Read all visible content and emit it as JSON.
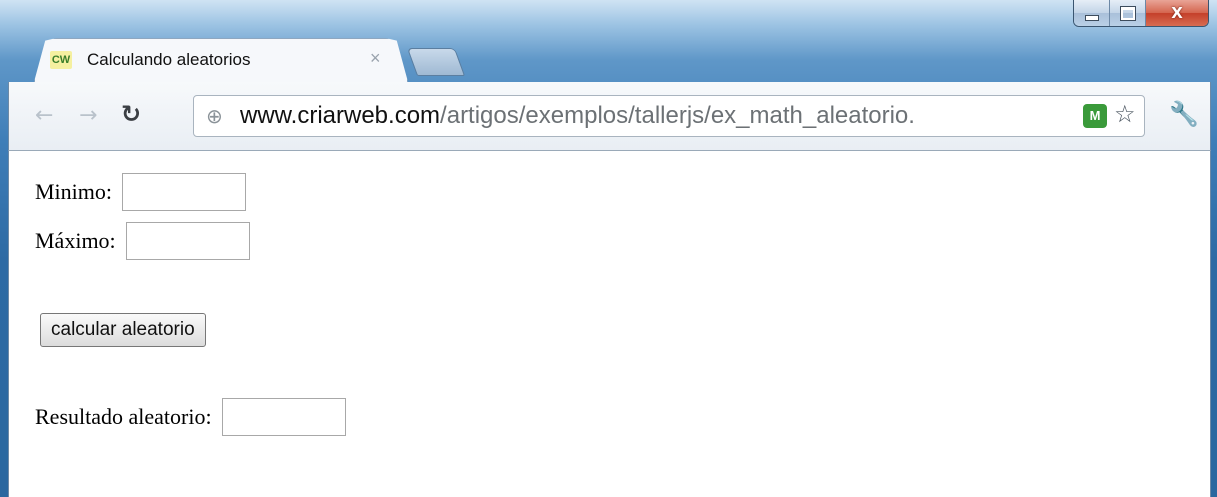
{
  "browser": {
    "tab": {
      "favicon_text": "CW",
      "title": "Calculando aleatorios",
      "close_glyph": "×"
    },
    "window_controls": {
      "close_glyph": "X"
    },
    "address": {
      "host": "www.criarweb.com",
      "path": "/artigos/exemplos/tallerjs/ex_math_aleatorio."
    },
    "icons": {
      "back": "back-arrow-icon",
      "forward": "forward-arrow-icon",
      "reload": "reload-icon",
      "globe": "globe-icon",
      "extension": "extension-shield-icon",
      "bookmark": "star-icon",
      "menu": "wrench-icon"
    },
    "extension_text": "M"
  },
  "form": {
    "min_label": "Minimo:",
    "min_value": "",
    "max_label": "Máximo:",
    "max_value": "",
    "button_label": "calcular aleatorio",
    "result_label": "Resultado aleatorio:",
    "result_value": ""
  }
}
